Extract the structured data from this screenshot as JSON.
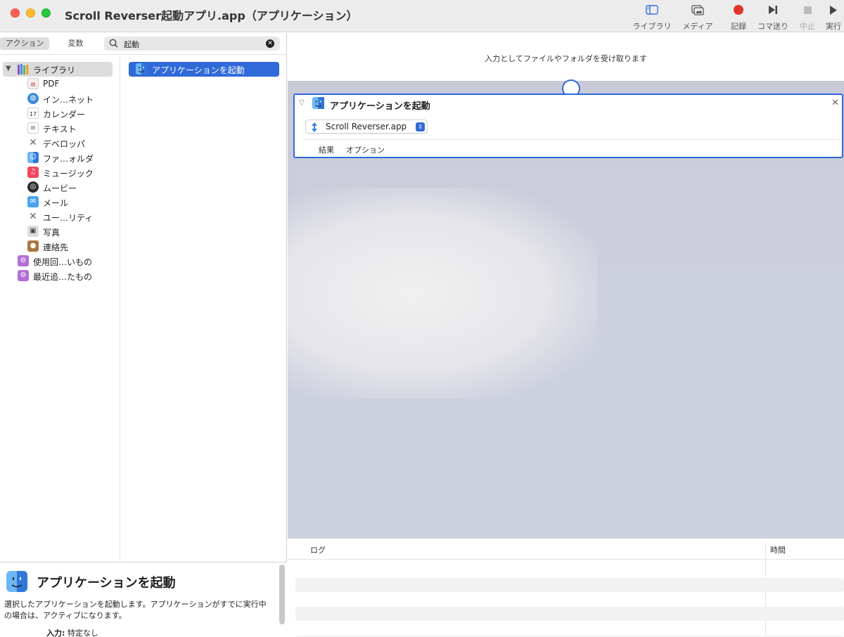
{
  "window": {
    "title": "Scroll Reverser起動アプリ.app（アプリケーション）"
  },
  "toolbar": {
    "library": "ライブラリ",
    "media": "メディア",
    "record": "記録",
    "step": "コマ送り",
    "stop": "中止",
    "run": "実行"
  },
  "segments": {
    "actions": "アクション",
    "variables": "変数"
  },
  "search": {
    "value": "起動"
  },
  "library": {
    "label": "ライブラリ",
    "categories": [
      {
        "label": "PDF",
        "icon": "pdf-icon"
      },
      {
        "label": "イン…ネット",
        "icon": "globe-icon"
      },
      {
        "label": "カレンダー",
        "icon": "calendar-icon"
      },
      {
        "label": "テキスト",
        "icon": "text-icon"
      },
      {
        "label": "デベロッパ",
        "icon": "developer-icon"
      },
      {
        "label": "ファ…ォルダ",
        "icon": "finder-icon"
      },
      {
        "label": "ミュージック",
        "icon": "music-icon"
      },
      {
        "label": "ムービー",
        "icon": "movie-icon"
      },
      {
        "label": "メール",
        "icon": "mail-icon"
      },
      {
        "label": "ユー…リティ",
        "icon": "utility-icon"
      },
      {
        "label": "写真",
        "icon": "photo-icon"
      },
      {
        "label": "連絡先",
        "icon": "contacts-icon"
      }
    ],
    "smart_groups": [
      {
        "label": "使用回…いもの",
        "icon": "smart-folder-icon"
      },
      {
        "label": "最近追…たもの",
        "icon": "smart-folder-icon"
      }
    ]
  },
  "actions": [
    {
      "label": "アプリケーションを起動",
      "icon": "finder-icon"
    }
  ],
  "description": {
    "title": "アプリケーションを起動",
    "body": "選択したアプリケーションを起動します。アプリケーションがすでに実行中の場合は、アクティブになります。",
    "input_label": "入力:",
    "input_value": "特定なし"
  },
  "workflow": {
    "input_text": "入力としてファイルやフォルダを受け取ります",
    "card": {
      "title": "アプリケーションを起動",
      "app_value": "Scroll Reverser.app",
      "results": "結果",
      "options": "オプション"
    }
  },
  "log": {
    "col_log": "ログ",
    "col_time": "時間"
  },
  "colors": {
    "accent": "#2f6ad8",
    "record": "#e0362c"
  }
}
